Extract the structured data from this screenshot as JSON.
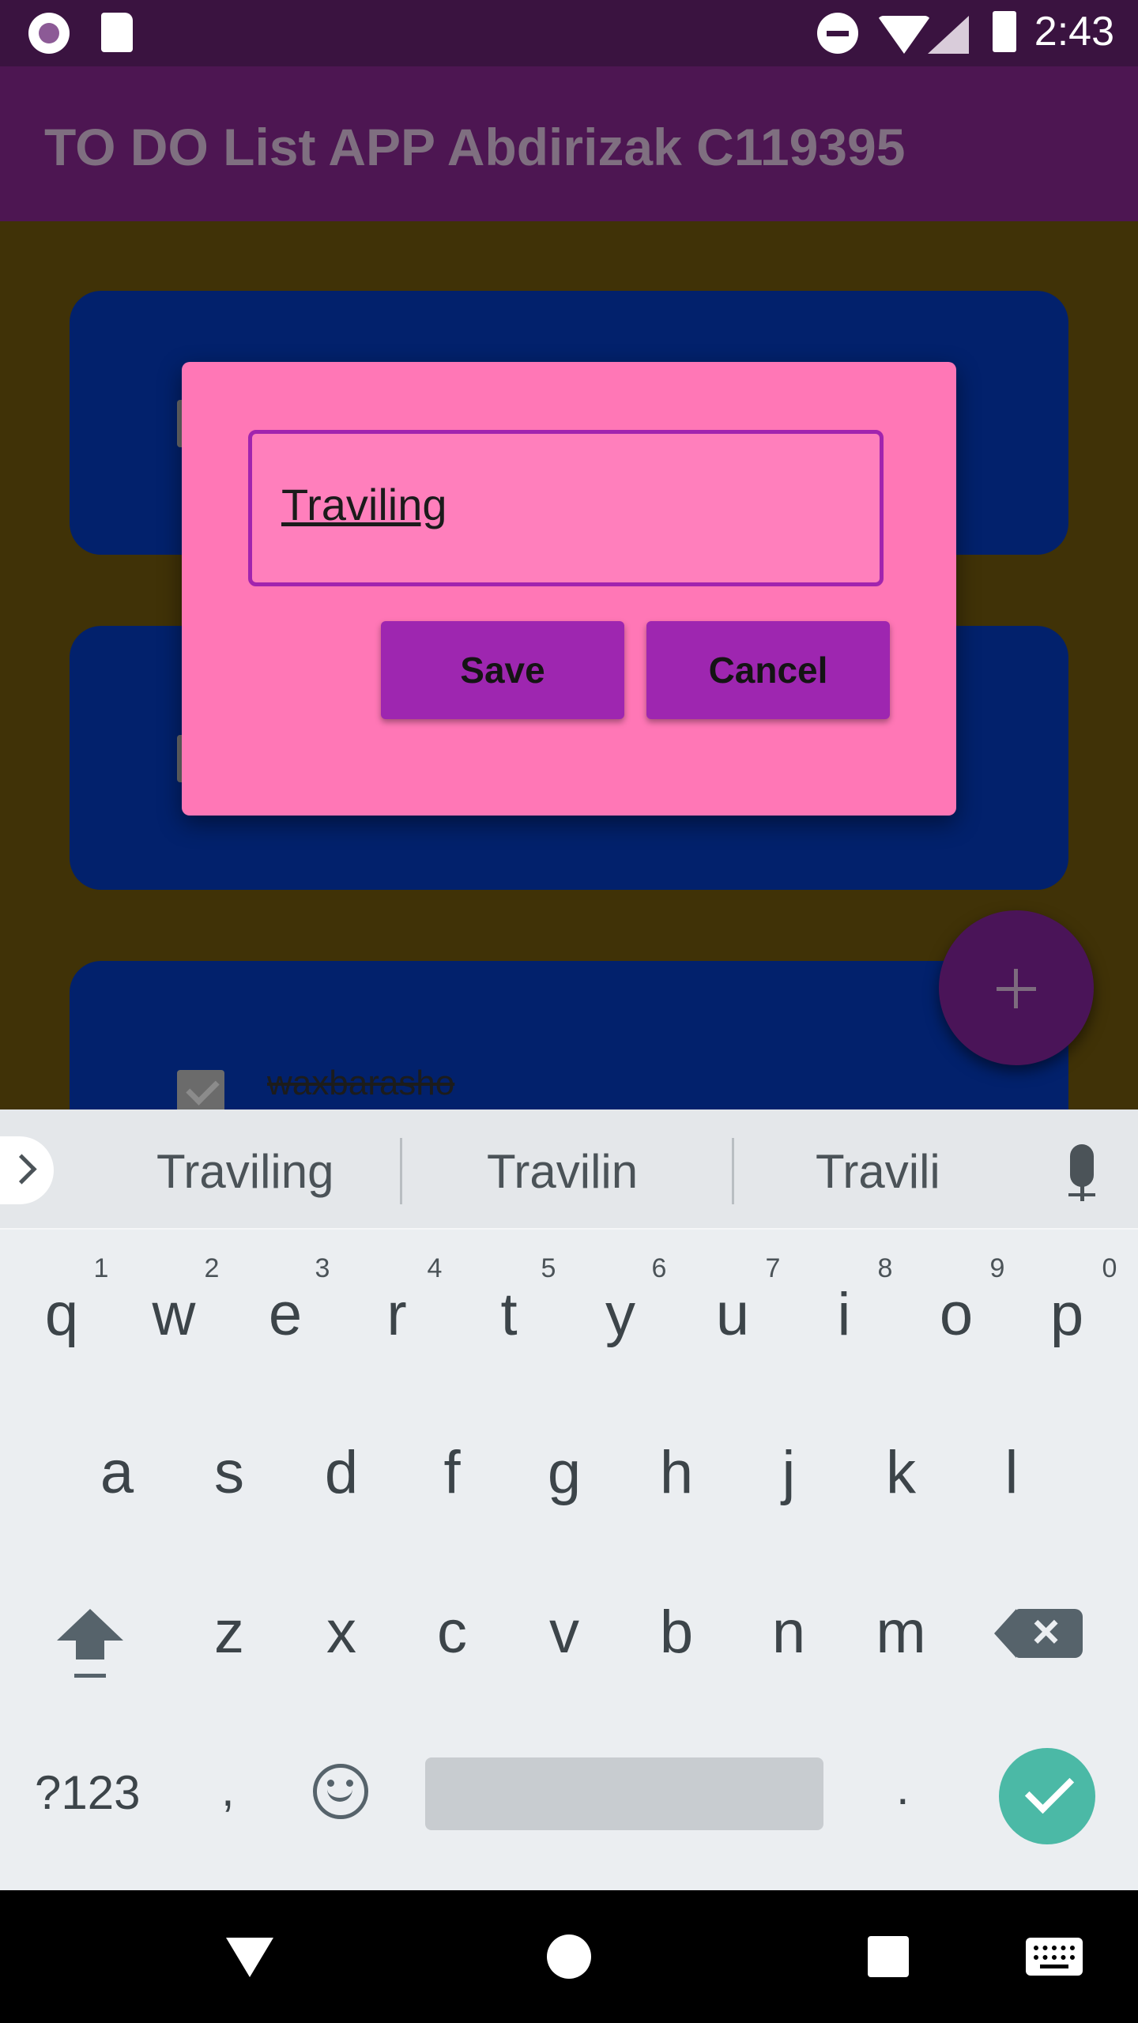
{
  "status_bar": {
    "time": "2:43",
    "icons": [
      "record-icon",
      "sd-card-icon",
      "do-not-disturb-icon",
      "wifi-icon",
      "cellular-signal-icon",
      "battery-icon"
    ]
  },
  "app_bar": {
    "title": "TO DO List APP Abdirizak C119395"
  },
  "todo_list": {
    "items": [
      {
        "text": "",
        "checked": false
      },
      {
        "text": "",
        "checked": false
      },
      {
        "text": "waxbarasho",
        "checked": true
      }
    ]
  },
  "fab": {
    "icon": "plus-icon"
  },
  "dialog": {
    "input_value": "Traviling",
    "save_label": "Save",
    "cancel_label": "Cancel"
  },
  "keyboard": {
    "suggestions": [
      "Traviling",
      "Travilin",
      "Travili"
    ],
    "row1": [
      "q",
      "w",
      "e",
      "r",
      "t",
      "y",
      "u",
      "i",
      "o",
      "p"
    ],
    "row1_hints": [
      "1",
      "2",
      "3",
      "4",
      "5",
      "6",
      "7",
      "8",
      "9",
      "0"
    ],
    "row2": [
      "a",
      "s",
      "d",
      "f",
      "g",
      "h",
      "j",
      "k",
      "l"
    ],
    "row3": [
      "z",
      "x",
      "c",
      "v",
      "b",
      "n",
      "m"
    ],
    "symbols_label": "?123",
    "comma": ",",
    "period": "."
  },
  "colors": {
    "dialog_bg": "#ff77b6",
    "button_bg": "#9e26b0",
    "card_bg": "#02216c",
    "enter_key": "#4bb9a6"
  }
}
